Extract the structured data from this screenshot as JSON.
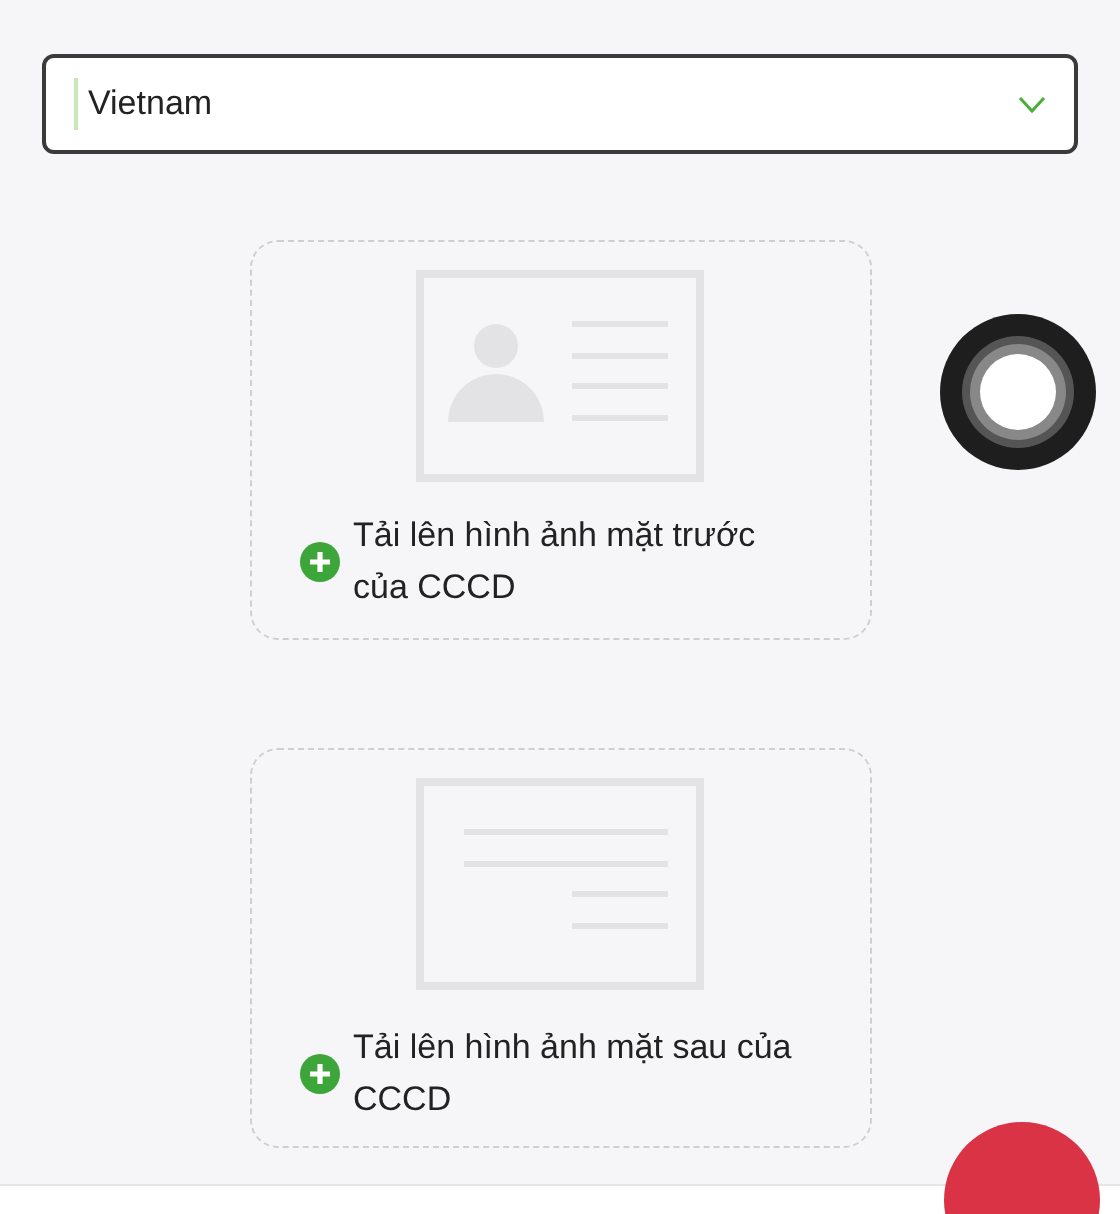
{
  "country_select": {
    "value": "Vietnam"
  },
  "upload_cards": [
    {
      "kind": "front",
      "label": "Tải lên hình ảnh mặt trước của CCCD"
    },
    {
      "kind": "back",
      "label": "Tải lên hình ảnh mặt sau của CCCD"
    }
  ]
}
